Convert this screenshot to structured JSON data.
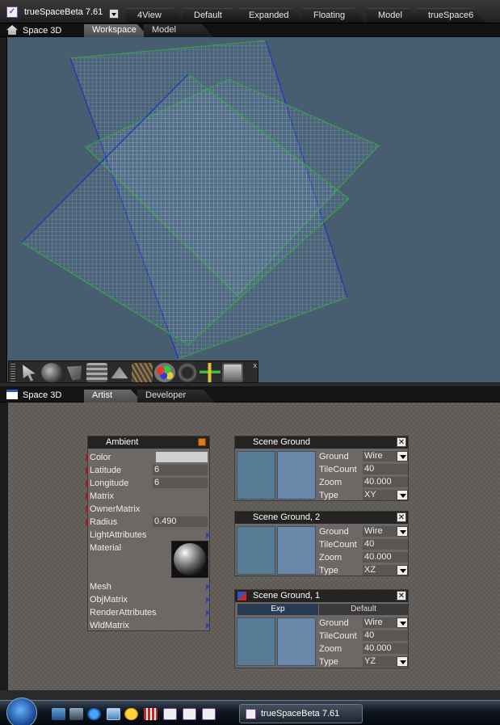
{
  "app": {
    "title": "trueSpaceBeta 7.61"
  },
  "workspace_tabs": [
    "4View",
    "Default",
    "Expanded",
    "Floating",
    "Model",
    "trueSpace6"
  ],
  "top_panel": {
    "label": "Space 3D",
    "tabs": [
      "Workspace",
      "Model"
    ],
    "active_tab": 0
  },
  "bottom_panel": {
    "label": "Space 3D",
    "tabs": [
      "Artist",
      "Developer"
    ],
    "active_tab": 0
  },
  "toolbar": {
    "icons": [
      "select-arrow-icon",
      "rotate-object-icon",
      "primitive-cube-icon",
      "layers-icon",
      "paint-icon",
      "grid-icon",
      "material-palette-icon",
      "torus-icon",
      "add-light-icon",
      "panel-icon"
    ],
    "close_label": "x"
  },
  "ambient_panel": {
    "title": "Ambient",
    "rows": [
      {
        "name": "Color",
        "value": ""
      },
      {
        "name": "Latitude",
        "value": "6"
      },
      {
        "name": "Longitude",
        "value": "6"
      },
      {
        "name": "Matrix",
        "value": ""
      },
      {
        "name": "OwnerMatrix",
        "value": ""
      },
      {
        "name": "Radius",
        "value": "0.490"
      },
      {
        "name": "LightAttributes",
        "value": ""
      },
      {
        "name": "Material",
        "value": ""
      },
      {
        "name": "Mesh",
        "value": ""
      },
      {
        "name": "ObjMatrix",
        "value": ""
      },
      {
        "name": "RenderAttributes",
        "value": ""
      },
      {
        "name": "WldMatrix",
        "value": ""
      }
    ]
  },
  "scene_grounds": [
    {
      "title": "Scene Ground",
      "ground": "Wire",
      "tilecount": "40",
      "zoom": "40.000",
      "type": "XY"
    },
    {
      "title": "Scene Ground, 2",
      "ground": "Wire",
      "tilecount": "40",
      "zoom": "40.000",
      "type": "XZ"
    },
    {
      "title": "Scene Ground, 1",
      "ground": "Wire",
      "tilecount": "40",
      "zoom": "40.000",
      "type": "YZ",
      "subtabs": [
        "Exp",
        "Default"
      ]
    }
  ],
  "scene_ground_labels": {
    "ground": "Ground",
    "tilecount": "TileCount",
    "zoom": "Zoom",
    "type": "Type"
  },
  "close_x": "✕",
  "taskbar": {
    "task_title": "trueSpaceBeta 7.61"
  },
  "colors": {
    "viewport_bg": "#485d70",
    "grid_blue": "#1f2fbf",
    "grid_green": "#2faa3a",
    "mesh": "#9cc4e0"
  }
}
